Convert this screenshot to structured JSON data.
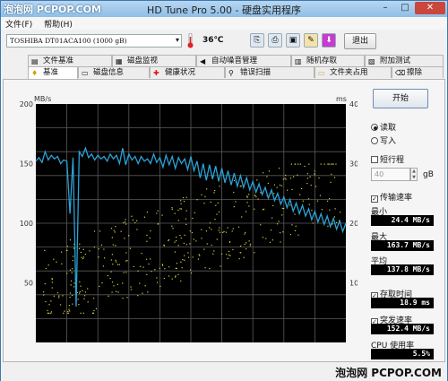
{
  "window": {
    "watermark": "泡泡网 PCPOP.COM",
    "title": "HD Tune Pro 5.00 - 硬盘实用程序",
    "minimize": "–",
    "maximize": "□",
    "close": "✕"
  },
  "menu": [
    {
      "label": "文件(F)"
    },
    {
      "label": "帮助(H)"
    }
  ],
  "toolbar": {
    "drive": "TOSHIBA DT01ACA100 (1000 gB)",
    "drive_arrow": "▾",
    "temperature": "36℃",
    "exit_label": "退出",
    "icons": [
      {
        "name": "copy-info-icon",
        "glyph": "⎘"
      },
      {
        "name": "copy-screenshot-icon",
        "glyph": "⎙"
      },
      {
        "name": "save-icon",
        "glyph": "▣"
      },
      {
        "name": "options-icon",
        "glyph": "✎"
      },
      {
        "name": "download-icon",
        "glyph": "⬇"
      }
    ]
  },
  "tabs_row1": [
    {
      "label": "文件基准",
      "icon": "▤"
    },
    {
      "label": "磁盘监视",
      "icon": "▦"
    },
    {
      "label": "自动噪音管理",
      "icon": "◀"
    },
    {
      "label": "随机存取",
      "icon": "▥"
    },
    {
      "label": "附加测试",
      "icon": "▧"
    }
  ],
  "tabs_row2": [
    {
      "label": "基准",
      "icon": "♦",
      "active": true
    },
    {
      "label": "磁盘信息",
      "icon": "▭"
    },
    {
      "label": "健康状况",
      "icon": "✚"
    },
    {
      "label": "错误扫描",
      "icon": "⚲"
    },
    {
      "label": "文件夹占用",
      "icon": "▭"
    },
    {
      "label": "擦除",
      "icon": "⌫"
    }
  ],
  "chart_data": {
    "type": "line",
    "left_axis": {
      "label": "MB/s",
      "ticks": [
        200,
        150,
        100,
        50
      ],
      "range": [
        0,
        200
      ]
    },
    "right_axis": {
      "label": "ms",
      "ticks": [
        40,
        30,
        20,
        10
      ],
      "range": [
        0,
        40
      ]
    },
    "background": "#000000",
    "grid": true,
    "colors": {
      "transfer_rate": "#2aa3d8",
      "access_time": "#d8d23a"
    },
    "transfer_rate_series": {
      "x": [
        0,
        1,
        2,
        3,
        4,
        5,
        6,
        7,
        8,
        9,
        10,
        11,
        12,
        13,
        14,
        15,
        16,
        17,
        18,
        19,
        20,
        21,
        22,
        23,
        24,
        25,
        26,
        27,
        28,
        29,
        30,
        31,
        32,
        33,
        34,
        35,
        36,
        37,
        38,
        39,
        40,
        41,
        42,
        43,
        44,
        45,
        46,
        47,
        48,
        49,
        50,
        51,
        52,
        53,
        54,
        55,
        56,
        57,
        58,
        59,
        60,
        61,
        62,
        63,
        64,
        65,
        66,
        67,
        68,
        69,
        70,
        71,
        72,
        73,
        74,
        75,
        76,
        77,
        78,
        79,
        80,
        81,
        82,
        83,
        84,
        85,
        86,
        87,
        88,
        89,
        90,
        91,
        92,
        93,
        94,
        95,
        96,
        97,
        98,
        99,
        100
      ],
      "values": [
        152,
        155,
        151,
        160,
        153,
        157,
        154,
        156,
        150,
        153,
        152,
        108,
        155,
        30,
        160,
        156,
        163,
        155,
        158,
        153,
        157,
        154,
        156,
        152,
        158,
        154,
        157,
        150,
        163,
        149,
        158,
        153,
        156,
        150,
        156,
        152,
        154,
        150,
        158,
        151,
        155,
        147,
        157,
        149,
        156,
        146,
        155,
        150,
        154,
        145,
        156,
        144,
        152,
        138,
        150,
        136,
        149,
        137,
        148,
        135,
        146,
        134,
        144,
        132,
        142,
        131,
        140,
        130,
        138,
        128,
        135,
        126,
        133,
        124,
        130,
        121,
        128,
        119,
        125,
        116,
        122,
        113,
        120,
        110,
        117,
        108,
        115,
        106,
        112,
        103,
        110,
        101,
        108,
        99,
        106,
        97,
        104,
        95,
        102,
        93,
        100
      ]
    },
    "access_time_summary": {
      "min_ms": 5,
      "max_ms": 30,
      "note": "scatter points"
    }
  },
  "sidebar": {
    "start_label": "开始",
    "read_label": "读取",
    "write_label": "写入",
    "short_stroke_label": "短行程",
    "short_stroke_value": "40",
    "gb_label": "gB",
    "transfer_rate_label": "传输速率",
    "min_label": "最小",
    "min_value": "24.4 MB/s",
    "max_label": "最大",
    "max_value": "163.7 MB/s",
    "avg_label": "平均",
    "avg_value": "137.8 MB/s",
    "access_time_label": "存取时间",
    "access_time_value": "18.9 ms",
    "burst_rate_label": "突发速率",
    "burst_rate_value": "152.4 MB/s",
    "cpu_label": "CPU 使用率",
    "cpu_value": "5.5%"
  },
  "footer": {
    "watermark": "泡泡网 PCPOP.COM"
  }
}
